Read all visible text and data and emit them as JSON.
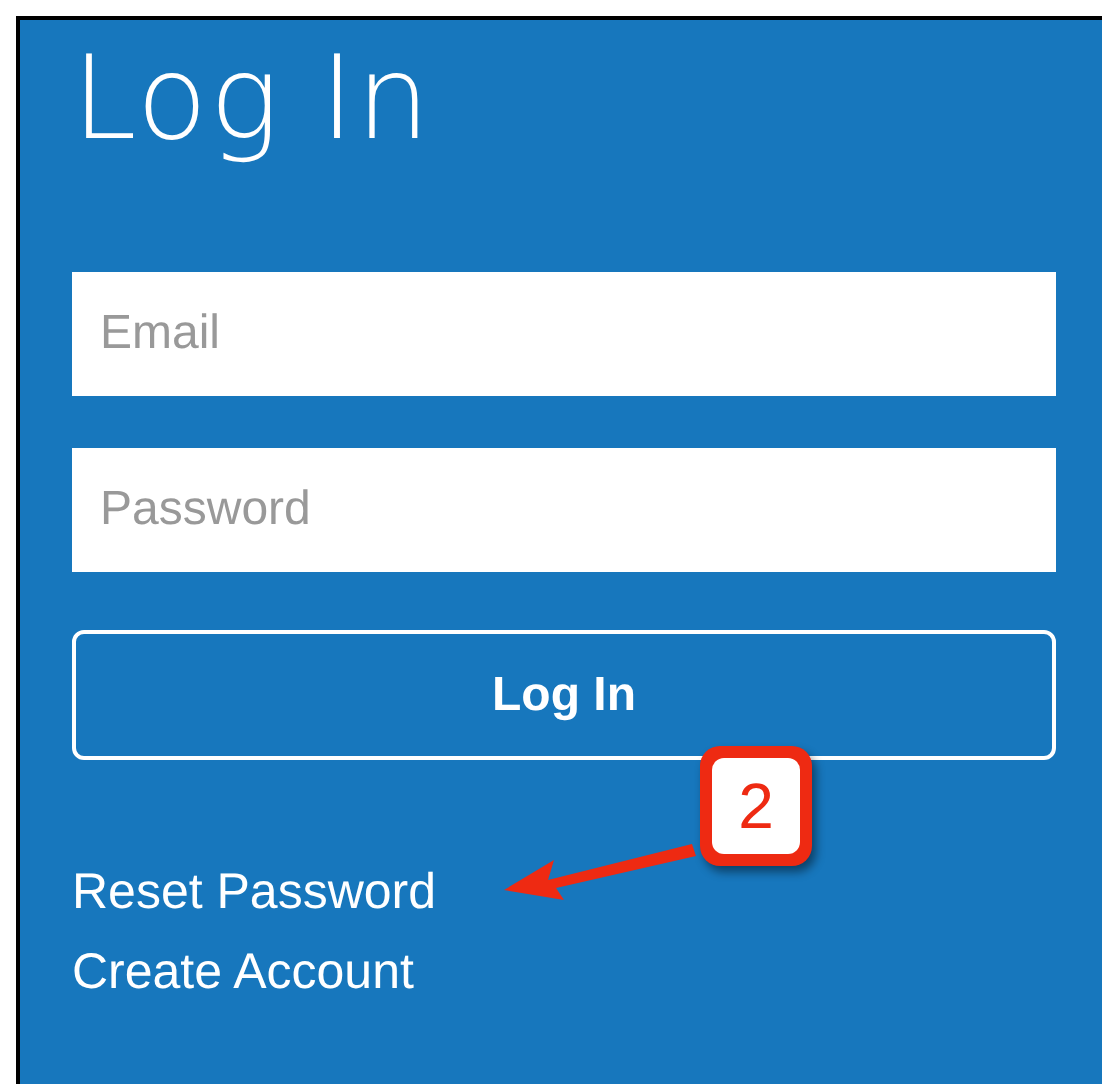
{
  "panel": {
    "title": "Log In"
  },
  "fields": [
    {
      "placeholder": "Email"
    },
    {
      "placeholder": "Password"
    }
  ],
  "button": {
    "label": "Log In"
  },
  "links": [
    "Reset Password",
    "Create Account"
  ],
  "annotation": {
    "label": "2"
  }
}
